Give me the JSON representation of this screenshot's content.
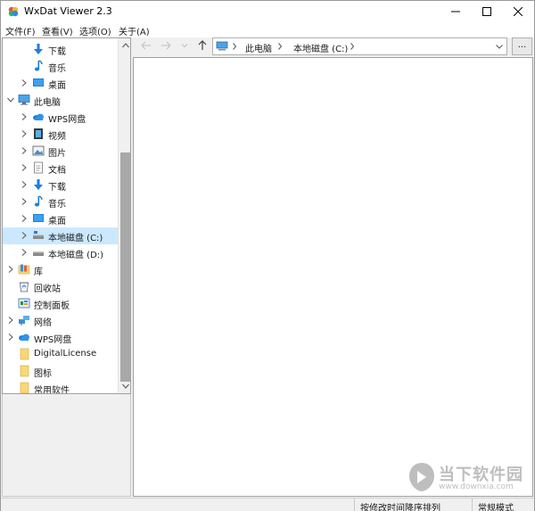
{
  "window": {
    "title": "WxDat Viewer 2.3"
  },
  "menu": {
    "items": [
      {
        "label": "文件(F)"
      },
      {
        "label": "查看(V)"
      },
      {
        "label": "选项(O)"
      },
      {
        "label": "关于(A)"
      }
    ]
  },
  "tree": {
    "items": [
      {
        "label": "下载",
        "icon": "download-arrow-icon",
        "expandable": false,
        "selected": false
      },
      {
        "label": "音乐",
        "icon": "music-note-icon",
        "expandable": false,
        "selected": false
      },
      {
        "label": "桌面",
        "icon": "desktop-icon",
        "expandable": true,
        "selected": false
      },
      {
        "label": "此电脑",
        "icon": "computer-icon",
        "expandable": true,
        "expanded": true,
        "selected": false
      },
      {
        "label": "WPS网盘",
        "icon": "cloud-icon",
        "expandable": true,
        "selected": false
      },
      {
        "label": "视频",
        "icon": "video-icon",
        "expandable": true,
        "selected": false
      },
      {
        "label": "图片",
        "icon": "picture-icon",
        "expandable": true,
        "selected": false
      },
      {
        "label": "文档",
        "icon": "document-icon",
        "expandable": true,
        "selected": false
      },
      {
        "label": "下载",
        "icon": "download-arrow-icon",
        "expandable": true,
        "selected": false
      },
      {
        "label": "音乐",
        "icon": "music-note-icon",
        "expandable": true,
        "selected": false
      },
      {
        "label": "桌面",
        "icon": "desktop-icon",
        "expandable": true,
        "selected": false
      },
      {
        "label": "本地磁盘 (C:)",
        "icon": "drive-icon",
        "expandable": true,
        "selected": true
      },
      {
        "label": "本地磁盘 (D:)",
        "icon": "drive-icon",
        "expandable": true,
        "selected": false
      },
      {
        "label": "库",
        "icon": "library-icon",
        "expandable": true,
        "selected": false
      },
      {
        "label": "回收站",
        "icon": "recycle-bin-icon",
        "expandable": false,
        "selected": false
      },
      {
        "label": "控制面板",
        "icon": "control-panel-icon",
        "expandable": false,
        "selected": false
      },
      {
        "label": "网络",
        "icon": "network-icon",
        "expandable": true,
        "selected": false
      },
      {
        "label": "WPS网盘",
        "icon": "cloud-icon",
        "expandable": true,
        "selected": false
      },
      {
        "label": "DigitalLicense",
        "icon": "folder-icon",
        "expandable": false,
        "selected": false
      },
      {
        "label": "图标",
        "icon": "folder-icon",
        "expandable": false,
        "selected": false
      },
      {
        "label": "常用软件",
        "icon": "folder-icon",
        "expandable": false,
        "selected": false
      }
    ]
  },
  "address": {
    "crumbs": [
      "此电脑",
      "本地磁盘 (C:)"
    ],
    "browse_label": "..."
  },
  "status": {
    "sort_mode": "按修改时间降序排列",
    "view_mode": "常规模式"
  },
  "watermark": {
    "brand": "当下软件园",
    "url": "www.downxia.com"
  },
  "colors": {
    "selection": "#cce8ff",
    "accent_blue": "#1e7fd8",
    "folder_yellow": "#f8d775"
  }
}
